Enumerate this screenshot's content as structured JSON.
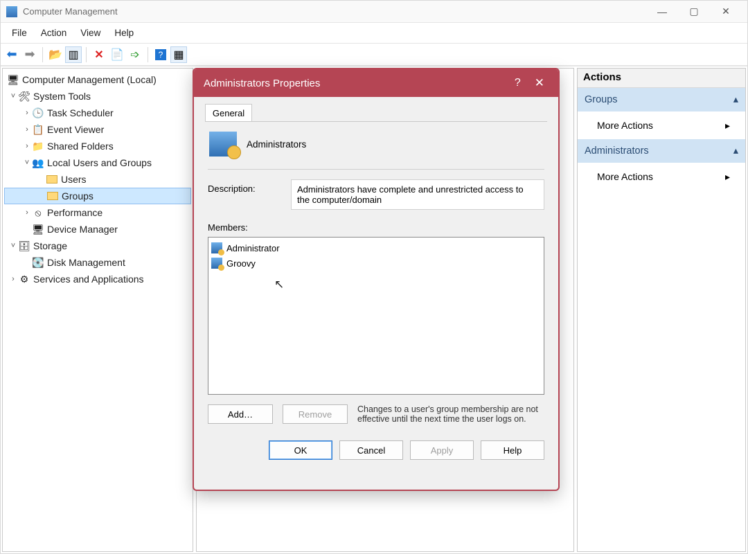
{
  "window": {
    "title": "Computer Management"
  },
  "menu": {
    "file": "File",
    "action": "Action",
    "view": "View",
    "help": "Help"
  },
  "tree": {
    "root": "Computer Management (Local)",
    "systools": "System Tools",
    "task": "Task Scheduler",
    "event": "Event Viewer",
    "shared": "Shared Folders",
    "lug": "Local Users and Groups",
    "users": "Users",
    "groups": "Groups",
    "perf": "Performance",
    "devmgr": "Device Manager",
    "storage": "Storage",
    "diskmgmt": "Disk Management",
    "services": "Services and Applications"
  },
  "actions": {
    "header": "Actions",
    "groups": "Groups",
    "more1": "More Actions",
    "admins": "Administrators",
    "more2": "More Actions"
  },
  "dialog": {
    "title": "Administrators Properties",
    "tab": "General",
    "group_name": "Administrators",
    "desc_label": "Description:",
    "desc_value": "Administrators have complete and unrestricted access to the computer/domain",
    "members_label": "Members:",
    "members": [
      "Administrator",
      "Groovy"
    ],
    "add": "Add…",
    "remove": "Remove",
    "note": "Changes to a user's group membership are not effective until the next time the user logs on.",
    "ok": "OK",
    "cancel": "Cancel",
    "apply": "Apply",
    "help": "Help"
  }
}
